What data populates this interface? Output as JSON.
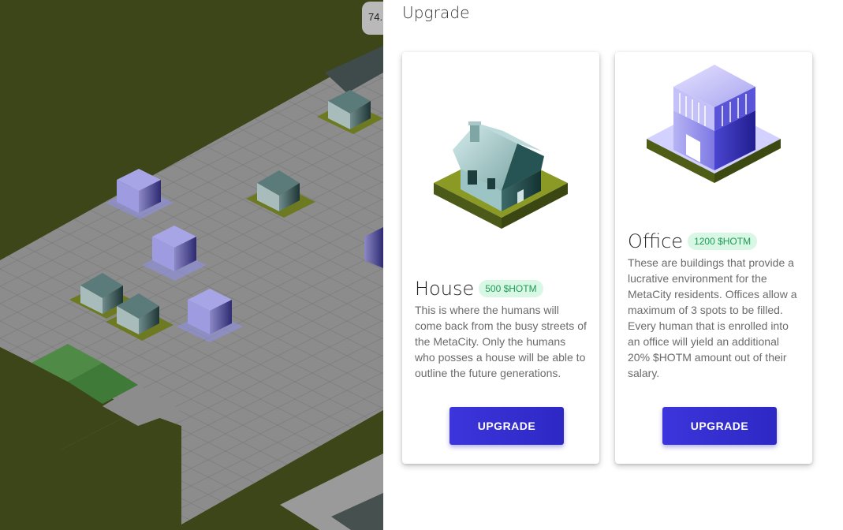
{
  "map": {
    "coord_text": "74."
  },
  "panel": {
    "title": "Upgrade",
    "cards": [
      {
        "name": "House",
        "price": "500 $HOTM",
        "description": "This is where the humans will come back from the busy streets of the MetaCity. Only the humans who posses a house will be able to outline the future generations.",
        "button_label": "UPGRADE",
        "image_icon": "house-icon"
      },
      {
        "name": "Office",
        "price": "1200 $HOTM",
        "description": "These are buildings that provide a lucrative environment for the MetaCity residents. Offices allow a maximum of 3 spots to be filled. Every human that is enrolled into an office will yield an additional 20% $HOTM amount out of their salary.",
        "button_label": "UPGRADE",
        "image_icon": "office-icon"
      }
    ]
  },
  "colors": {
    "accent": "#3c35dc",
    "badge_bg": "#d8f7e4",
    "badge_text": "#1f9a55",
    "grass": "#3d4618",
    "road": "#8a8a8a"
  }
}
